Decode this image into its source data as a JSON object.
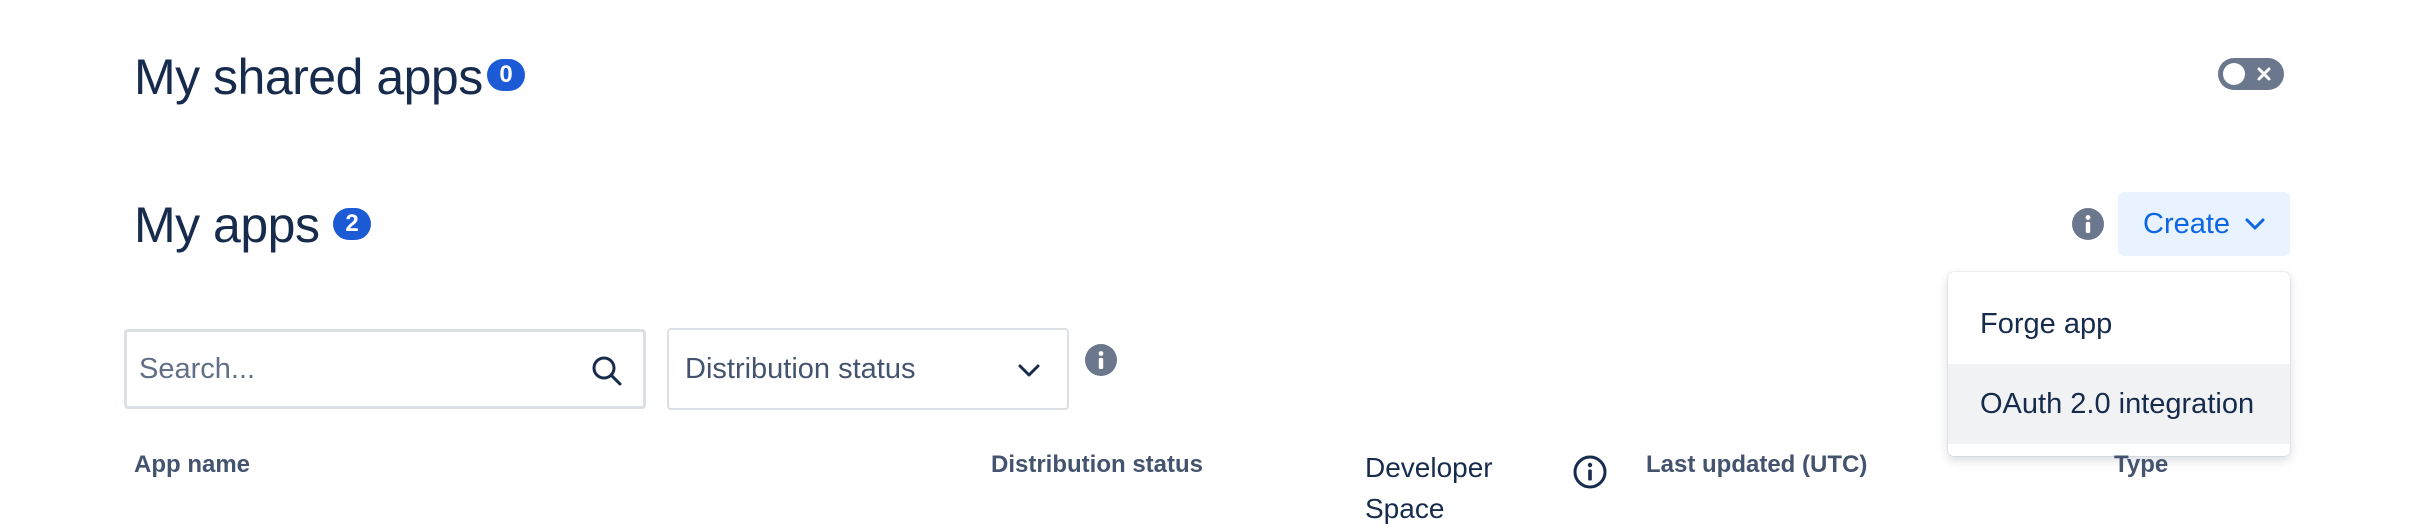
{
  "shared_apps": {
    "title": "My shared apps",
    "count": "0",
    "toggle_state": "off"
  },
  "my_apps": {
    "title": "My apps",
    "count": "2",
    "create_label": "Create",
    "create_menu": {
      "items": [
        {
          "label": "Forge app"
        },
        {
          "label": "OAuth 2.0 integration"
        }
      ]
    }
  },
  "filters": {
    "search_placeholder": "Search...",
    "search_value": "",
    "distribution_status": "Distribution status"
  },
  "table": {
    "columns": [
      {
        "label": "App name"
      },
      {
        "label": "Distribution status"
      },
      {
        "label": "Developer Space"
      },
      {
        "label": "Last updated (UTC)"
      },
      {
        "label": "Type"
      }
    ]
  },
  "colors": {
    "heading": "#172b4d",
    "badge": "#1d5bd6",
    "link_blue": "#0c66e4",
    "create_bg": "#e9f2ff",
    "icon_gray": "#6b778c",
    "menu_hover": "#f1f2f4"
  },
  "icons": {
    "toggle_cross": "close-icon",
    "info": "info-icon",
    "search": "search-icon",
    "chevron": "chevron-down-icon",
    "info_outline": "info-outline-icon"
  }
}
